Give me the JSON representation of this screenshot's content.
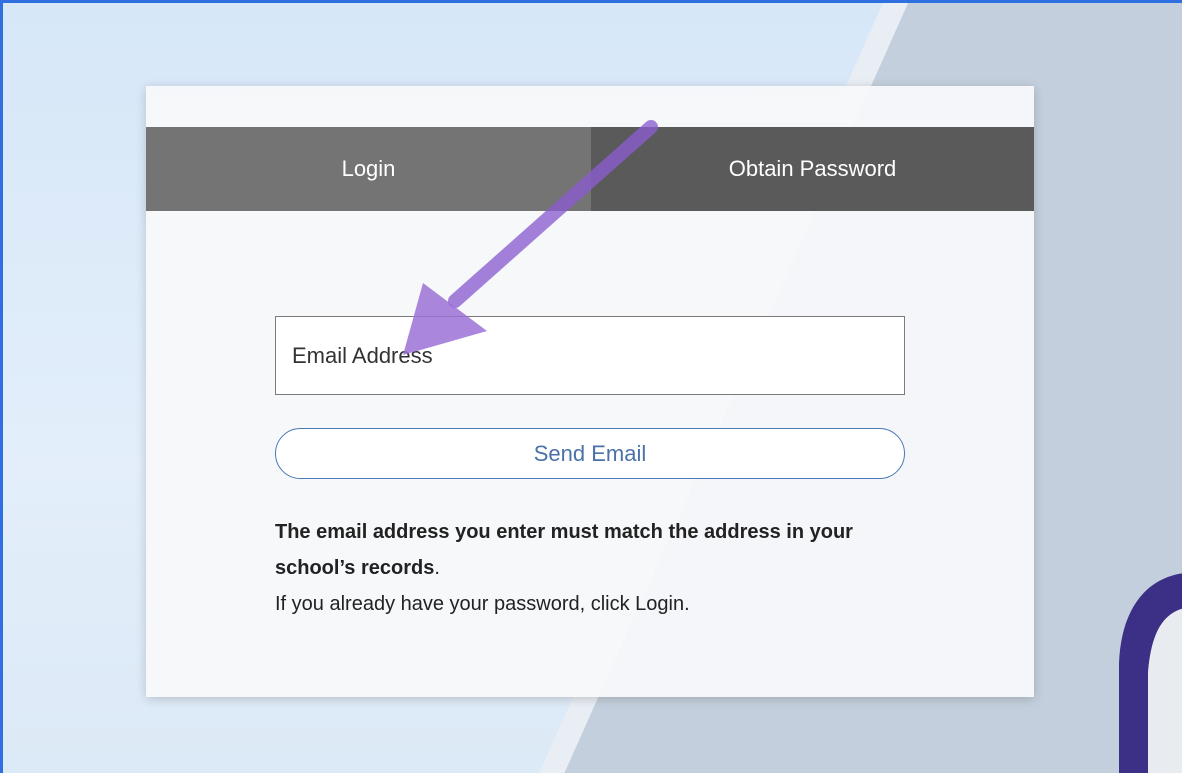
{
  "tabs": {
    "login_label": "Login",
    "obtain_password_label": "Obtain Password"
  },
  "form": {
    "email_placeholder": "Email Address",
    "send_button_label": "Send Email"
  },
  "info": {
    "bold_text": "The email address you enter must match the address in your school’s records",
    "period": ".",
    "secondary_text": "If you already have your password, click Login."
  },
  "colors": {
    "tab_login": "#747474",
    "tab_obtain": "#5a5a5a",
    "button_accent": "#4a72a8",
    "annotation_arrow": "#9b72d6"
  },
  "icons": {
    "annotation": "arrow-icon"
  }
}
